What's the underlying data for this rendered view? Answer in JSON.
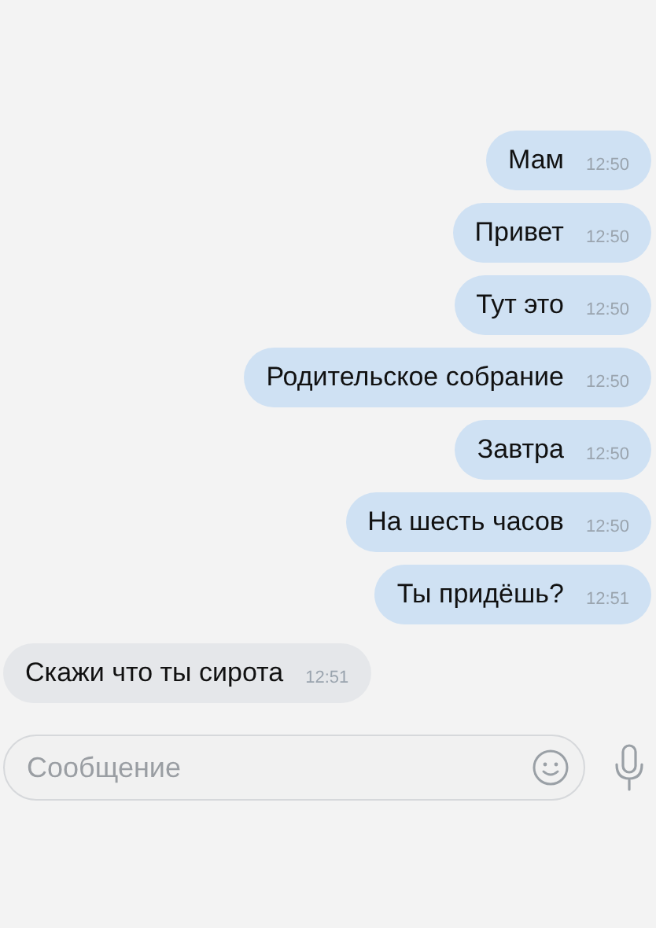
{
  "messages": [
    {
      "text": "Мам",
      "time": "12:50",
      "outgoing": true
    },
    {
      "text": "Привет",
      "time": "12:50",
      "outgoing": true
    },
    {
      "text": "Тут это",
      "time": "12:50",
      "outgoing": true
    },
    {
      "text": "Родительское собрание",
      "time": "12:50",
      "outgoing": true
    },
    {
      "text": "Завтра",
      "time": "12:50",
      "outgoing": true
    },
    {
      "text": "На шесть часов",
      "time": "12:50",
      "outgoing": true
    },
    {
      "text": "Ты придёшь?",
      "time": "12:51",
      "outgoing": true
    },
    {
      "text": "Скажи что ты сирота",
      "time": "12:51",
      "outgoing": false
    }
  ],
  "composer": {
    "placeholder": "Сообщение"
  }
}
